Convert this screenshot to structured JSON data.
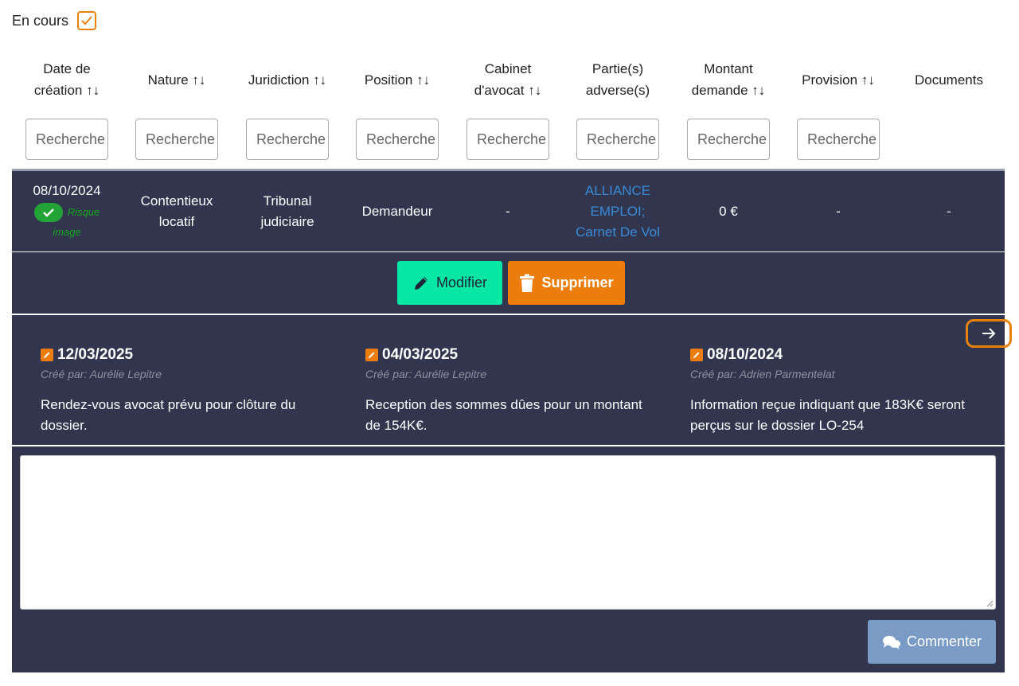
{
  "filter": {
    "label": "En cours",
    "checked": true
  },
  "columns": [
    {
      "line1": "Date de",
      "line2": "création ↑↓"
    },
    {
      "line1": "Nature ↑↓",
      "line2": ""
    },
    {
      "line1": "Juridiction ↑↓",
      "line2": ""
    },
    {
      "line1": "Position ↑↓",
      "line2": ""
    },
    {
      "line1": "Cabinet",
      "line2": "d'avocat ↑↓"
    },
    {
      "line1": "Partie(s)",
      "line2": "adverse(s)"
    },
    {
      "line1": "Montant",
      "line2": "demande ↑↓"
    },
    {
      "line1": "Provision ↑↓",
      "line2": ""
    },
    {
      "line1": "Documents",
      "line2": ""
    }
  ],
  "search_placeholder": "Recherche",
  "row": {
    "date": "08/10/2024",
    "risk_label_1": "Risque",
    "risk_label_2": "image",
    "nature_1": "Contentieux",
    "nature_2": "locatif",
    "juridiction_1": "Tribunal",
    "juridiction_2": "judiciaire",
    "position": "Demandeur",
    "cabinet": "-",
    "adverse_1": "ALLIANCE",
    "adverse_2": "EMPLOI;",
    "adverse_3": "Carnet De Vol",
    "montant": "0 €",
    "provision": "-",
    "documents": "-"
  },
  "actions": {
    "edit": "Modifier",
    "delete": "Supprimer"
  },
  "notes": [
    {
      "date": "12/03/2025",
      "author": "Créé par: Aurélie Lepitre",
      "text": "Rendez-vous avocat prévu pour clôture du dossier."
    },
    {
      "date": "04/03/2025",
      "author": "Créé par: Aurélie Lepitre",
      "text": "Reception des sommes dûes pour un montant de 154K€."
    },
    {
      "date": "08/10/2024",
      "author": "Créé par: Adrien Parmentelat",
      "text": "Information reçue indiquant que 183K€ seront perçus sur le dossier LO-254"
    }
  ],
  "comment_button": "Commenter",
  "colors": {
    "panel": "#31364e",
    "accent": "#ed7d0a",
    "edit": "#06e6a4",
    "link": "#3a8ad6",
    "comment": "#7a9bc6"
  }
}
